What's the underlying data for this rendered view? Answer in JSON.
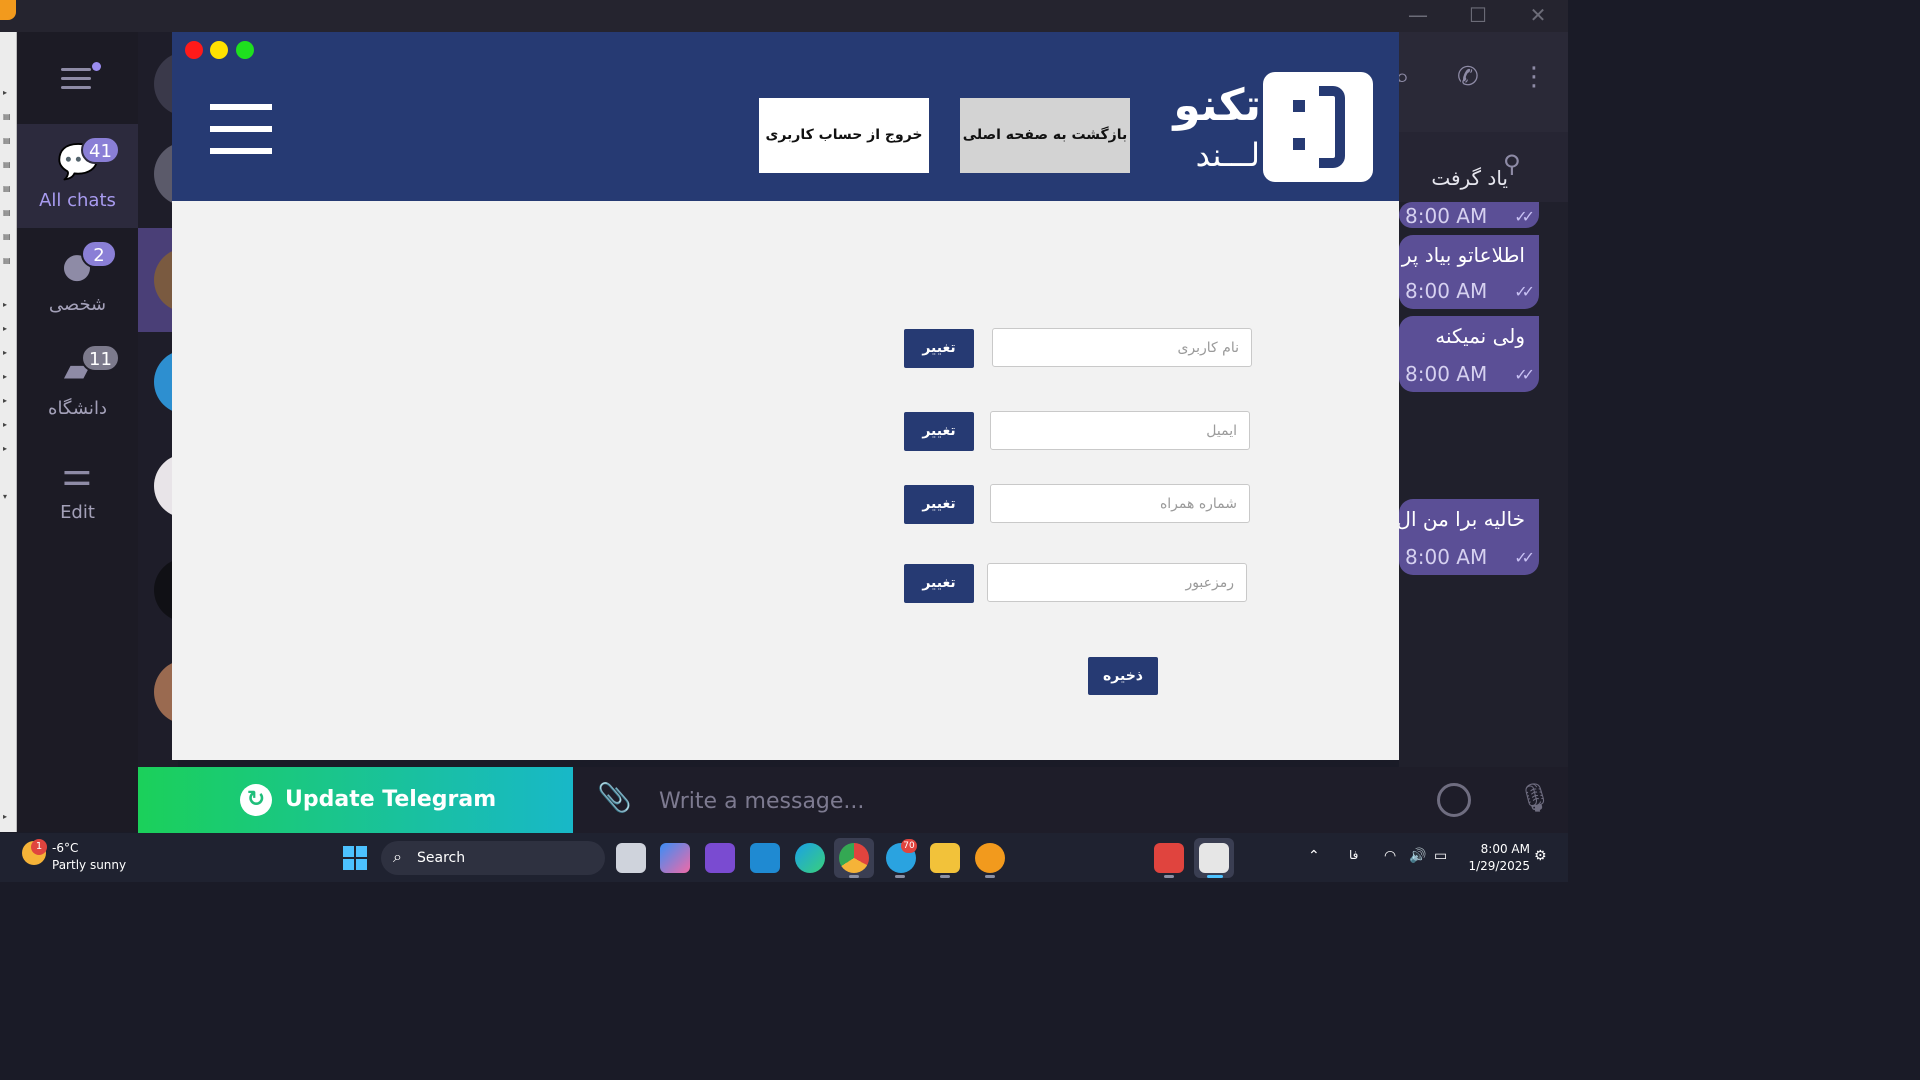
{
  "telegram": {
    "folders": [
      {
        "label": "All chats",
        "badge": "41",
        "icon": "chats-icon",
        "active": true
      },
      {
        "label": "شخصی",
        "badge": "2",
        "icon": "person-icon",
        "active": false
      },
      {
        "label": "دانشگاه",
        "badge": "11",
        "icon": "folder-icon",
        "active": false
      },
      {
        "label": "Edit",
        "badge": "",
        "icon": "sliders-icon",
        "active": false
      }
    ],
    "pinned_text": "یاد گرفت",
    "messages": [
      {
        "text": "",
        "time": "8:00 AM"
      },
      {
        "text": "اطلاعاتو بیاد پر",
        "time": "8:00 AM"
      },
      {
        "text": "ولی نمیکنه",
        "time": "8:00 AM"
      },
      {
        "text": "خالیه برا من ال",
        "time": "8:00 AM"
      }
    ],
    "update_button": "Update Telegram",
    "composer_placeholder": "Write a message..."
  },
  "app": {
    "header": {
      "logout_button": "خروج از حساب کاربری",
      "home_button": "بازگشت به صفحه اصلی",
      "logo_title": "تکنو",
      "logo_subtitle": "لـــند"
    },
    "form": {
      "fields": [
        {
          "placeholder": "نام کاربری",
          "button": "تغییر"
        },
        {
          "placeholder": "ایمیل",
          "button": "تغییر"
        },
        {
          "placeholder": "شماره همراه",
          "button": "تغییر"
        },
        {
          "placeholder": "رمزعبور",
          "button": "تغییر"
        }
      ],
      "save_button": "ذخیره"
    },
    "colors": {
      "primary": "#263a73",
      "background": "#f2f2f2"
    }
  },
  "taskbar": {
    "weather_temp": "-6°C",
    "weather_condition": "Partly sunny",
    "weather_badge": "1",
    "search_label": "Search",
    "telegram_badge": "70",
    "language": "فا",
    "time": "8:00 AM",
    "date": "1/29/2025"
  }
}
